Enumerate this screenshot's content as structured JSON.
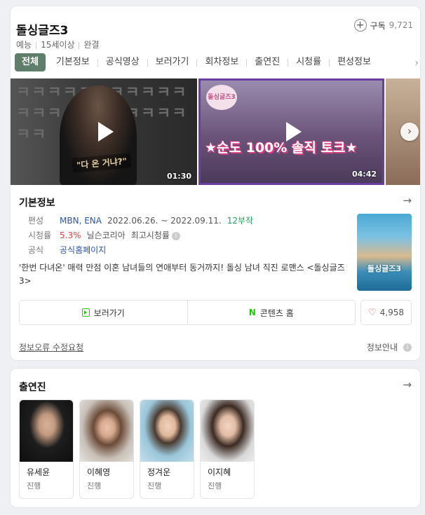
{
  "header": {
    "title": "돌싱글즈3",
    "meta": [
      "예능",
      "15세이상",
      "완결"
    ],
    "subscribe_label": "구독",
    "subscribe_count": "9,721"
  },
  "tabs": [
    "전체",
    "기본정보",
    "공식영상",
    "보러가기",
    "회차정보",
    "출연진",
    "시청률",
    "편성정보"
  ],
  "videos": [
    {
      "duration": "01:30",
      "overlay_text": "ㅋㅋㅋㅋㅋㅋㅋㅋㅋㅋㅋㅋㅋㅋㅋㅋㅋㅋㅋㅋㅋㅋㅋㅋ",
      "caption": "\"다 온 거냐?\""
    },
    {
      "duration": "04:42",
      "logo_text": "돌싱글즈3",
      "caption": "★순도 100% 솔직 토크★"
    },
    {
      "duration": ""
    }
  ],
  "basic_info": {
    "section_title": "기본정보",
    "broadcast_label": "편성",
    "broadcast_channel": "MBN, ENA",
    "broadcast_period": "2022.06.26. ~ 2022.09.11.",
    "episodes": "12부작",
    "rating_label": "시청률",
    "rating_value": "5.3%",
    "rating_source": "닐슨코리아",
    "rating_note": "최고시청률",
    "official_label": "공식",
    "official_link": "공식홈페이지",
    "synopsis": "'한번 다녀온' 매력 만점 이혼 남녀들의 연애부터 동거까지! 돌싱 남녀 직진 로맨스 <돌싱글즈3>",
    "poster_title": "돌싱글즈3"
  },
  "actions": {
    "watch_label": "보러가기",
    "content_home_label": "콘텐츠 홈",
    "like_count": "4,958"
  },
  "footer": {
    "report_label": "정보오류 수정요청",
    "info_label": "정보안내"
  },
  "cast": {
    "section_title": "출연진",
    "members": [
      {
        "name": "유세윤",
        "role": "진행"
      },
      {
        "name": "이혜영",
        "role": "진행"
      },
      {
        "name": "정겨운",
        "role": "진행"
      },
      {
        "name": "이지혜",
        "role": "진행"
      }
    ]
  },
  "colors": {
    "tab_active": "#5f7e6b",
    "link_blue": "#2855a8",
    "episodes_green": "#21a35a",
    "rating_red": "#e0403a",
    "naver_green": "#1ec800"
  }
}
